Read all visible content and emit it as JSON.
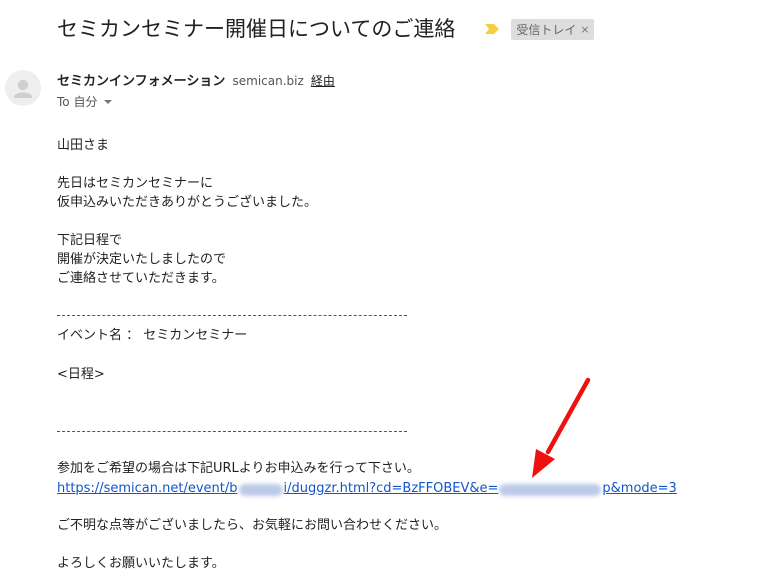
{
  "email": {
    "subject": "セミカンセミナー開催日についてのご連絡",
    "label": "受信トレイ",
    "label_close": "×",
    "sender_name": "セミカンインフォメーション",
    "sender_domain": "semican.biz",
    "via_label": "経由",
    "recipient": "To 自分",
    "body": {
      "greeting": "山田さま",
      "p1_line1": "先日はセミカンセミナーに",
      "p1_line2": "仮申込みいただきありがとうございました。",
      "p2_line1": "下記日程で",
      "p2_line2": "開催が決定いたしましたので",
      "p2_line3": "ご連絡させていただきます。",
      "event_name": "イベント名 ： セミカンセミナー",
      "schedule": "<日程>",
      "cta": "参加をご希望の場合は下記URLよりお申込みを行って下さい。",
      "link_part1": "https://semican.net/event/b",
      "link_part2": "i/duggzr.html?cd=BzFFOBEV&e=",
      "link_part3": "p&mode=3",
      "questions": "ご不明な点等がございましたら、お気軽にお問い合わせください。",
      "closing": "よろしくお願いいたします。"
    }
  },
  "colors": {
    "link": "#1155cc",
    "arrow": "#ee1111",
    "importance_marker": "#f4d03f",
    "label_chip_bg": "#dddddd"
  },
  "icons": {
    "avatar": "default-person-icon",
    "importance": "importance-marker-icon",
    "annotation": "red-arrow-annotation"
  }
}
